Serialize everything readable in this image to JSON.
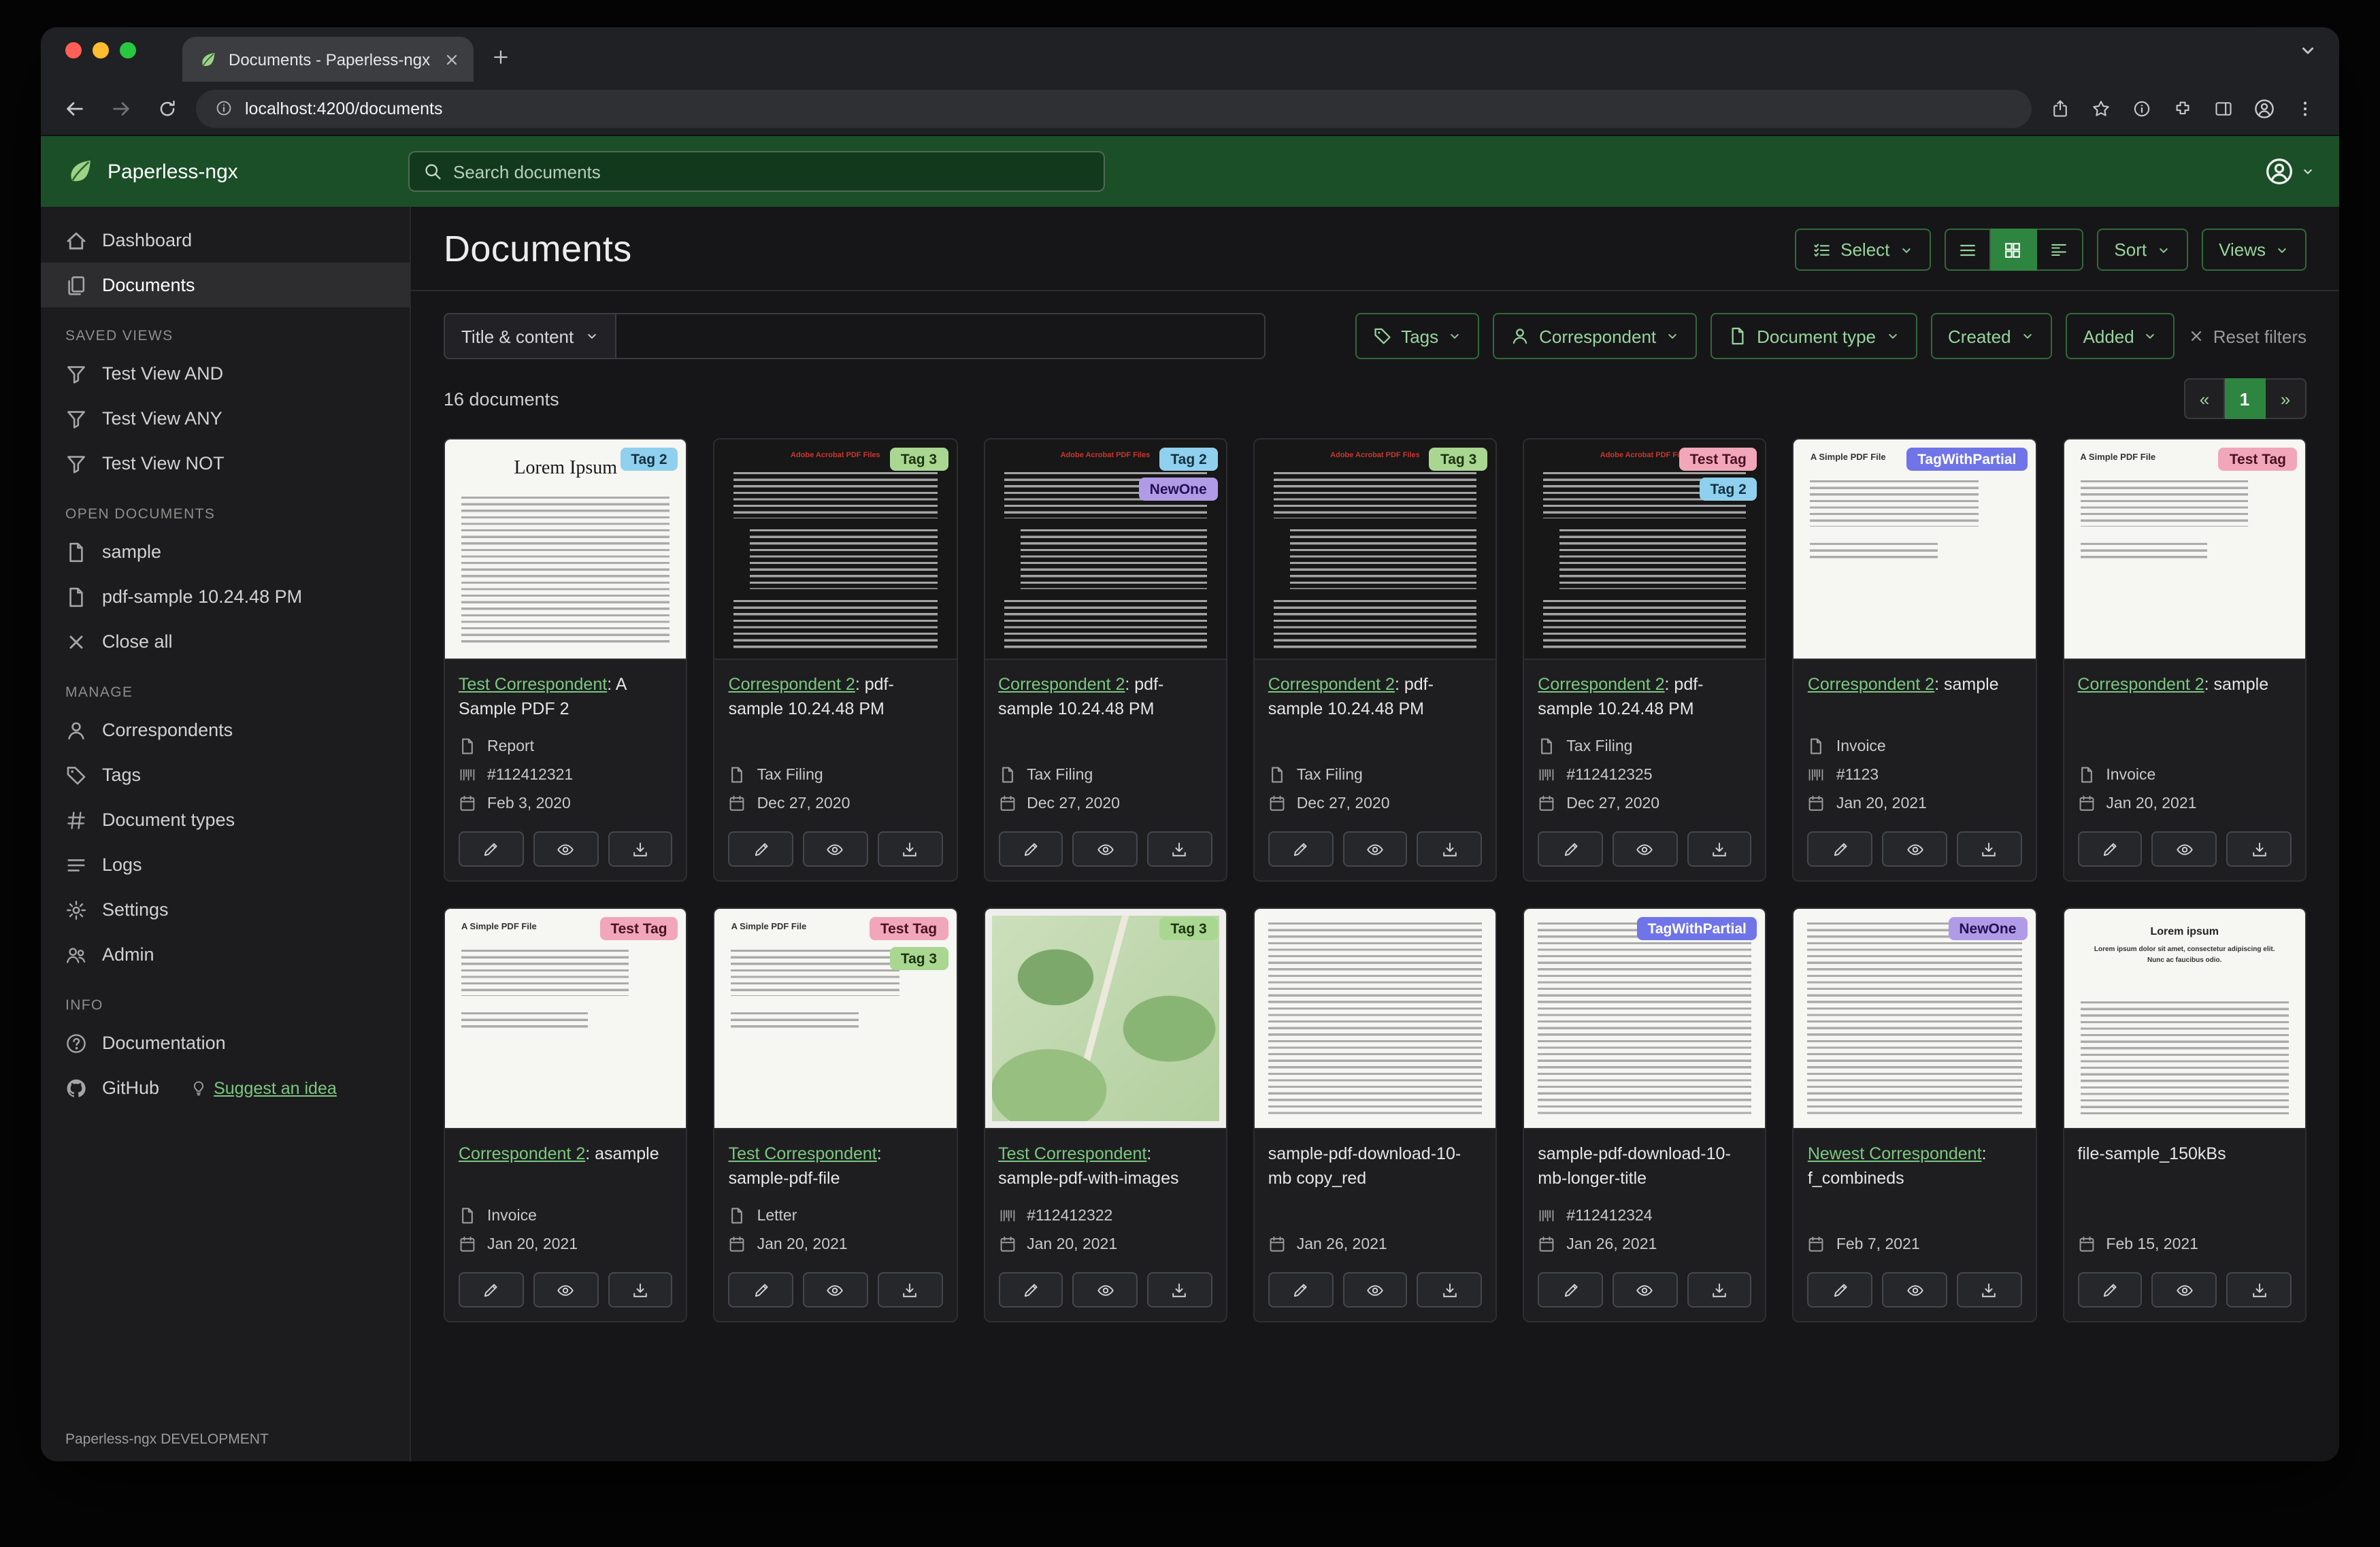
{
  "browser": {
    "tab_title": "Documents - Paperless-ngx",
    "url_host": "localhost:4200",
    "url_path": "/documents"
  },
  "header": {
    "app_name": "Paperless-ngx",
    "search_placeholder": "Search documents"
  },
  "sidebar": {
    "dashboard": "Dashboard",
    "documents": "Documents",
    "saved_views_heading": "SAVED VIEWS",
    "saved_views": [
      "Test View AND",
      "Test View ANY",
      "Test View NOT"
    ],
    "open_documents_heading": "OPEN DOCUMENTS",
    "open_documents": [
      "sample",
      "pdf-sample 10.24.48 PM"
    ],
    "close_all": "Close all",
    "manage_heading": "MANAGE",
    "manage": [
      "Correspondents",
      "Tags",
      "Document types",
      "Logs",
      "Settings",
      "Admin"
    ],
    "info_heading": "INFO",
    "documentation": "Documentation",
    "github": "GitHub",
    "suggest_idea": "Suggest an idea",
    "footer": "Paperless-ngx DEVELOPMENT"
  },
  "main": {
    "title": "Documents",
    "select_label": "Select",
    "sort_label": "Sort",
    "views_label": "Views",
    "filter": {
      "title_content": "Title & content",
      "tags": "Tags",
      "correspondent": "Correspondent",
      "document_type": "Document type",
      "created": "Created",
      "added": "Added",
      "reset": "Reset filters"
    },
    "count": "16 documents",
    "pagination": {
      "prev": "«",
      "page": "1",
      "next": "»"
    }
  },
  "tag_colors": {
    "Tag 2": {
      "bg": "#8fd0ee",
      "fg": "#12303f"
    },
    "Tag 3": {
      "bg": "#a9d792",
      "fg": "#1c330f"
    },
    "NewOne": {
      "bg": "#b09be6",
      "fg": "#241055"
    },
    "Test Tag": {
      "bg": "#f2a6ba",
      "fg": "#471223"
    },
    "TagWithPartial": {
      "bg": "#6f74e8",
      "fg": "#ffffff"
    }
  },
  "documents": [
    {
      "tags": [
        "Tag 2"
      ],
      "correspondent": "Test Correspondent",
      "title_suffix": ": A Sample PDF 2",
      "title": null,
      "doc_type": "Report",
      "asn": "#112412321",
      "date": "Feb 3, 2020",
      "thumb": {
        "type": "lorem",
        "text": "Lorem Ipsum"
      }
    },
    {
      "tags": [
        "Tag 3"
      ],
      "correspondent": "Correspondent 2",
      "title_suffix": ": pdf-sample 10.24.48 PM",
      "title": null,
      "doc_type": "Tax Filing",
      "asn": null,
      "date": "Dec 27, 2020",
      "thumb": {
        "type": "adobe",
        "text": "Adobe Acrobat PDF Files"
      }
    },
    {
      "tags": [
        "Tag 2",
        "NewOne"
      ],
      "correspondent": "Correspondent 2",
      "title_suffix": ": pdf-sample 10.24.48 PM",
      "title": null,
      "doc_type": "Tax Filing",
      "asn": null,
      "date": "Dec 27, 2020",
      "thumb": {
        "type": "adobe",
        "text": "Adobe Acrobat PDF Files"
      }
    },
    {
      "tags": [
        "Tag 3"
      ],
      "correspondent": "Correspondent 2",
      "title_suffix": ": pdf-sample 10.24.48 PM",
      "title": null,
      "doc_type": "Tax Filing",
      "asn": null,
      "date": "Dec 27, 2020",
      "thumb": {
        "type": "adobe",
        "text": "Adobe Acrobat PDF Files"
      }
    },
    {
      "tags": [
        "Test Tag",
        "Tag 2"
      ],
      "correspondent": "Correspondent 2",
      "title_suffix": ": pdf-sample 10.24.48 PM",
      "title": null,
      "doc_type": "Tax Filing",
      "asn": "#112412325",
      "date": "Dec 27, 2020",
      "thumb": {
        "type": "adobe",
        "text": "Adobe Acrobat PDF Files"
      }
    },
    {
      "tags": [
        "TagWithPartial"
      ],
      "correspondent": "Correspondent 2",
      "title_suffix": ": sample",
      "title": null,
      "doc_type": "Invoice",
      "asn": "#1123",
      "date": "Jan 20, 2021",
      "thumb": {
        "type": "simple",
        "text": "A Simple PDF File"
      }
    },
    {
      "tags": [
        "Test Tag"
      ],
      "correspondent": "Correspondent 2",
      "title_suffix": ": sample",
      "title": null,
      "doc_type": "Invoice",
      "asn": null,
      "date": "Jan 20, 2021",
      "thumb": {
        "type": "simple",
        "text": "A Simple PDF File"
      }
    },
    {
      "tags": [
        "Test Tag"
      ],
      "correspondent": "Correspondent 2",
      "title_suffix": ": asample",
      "title": null,
      "doc_type": "Invoice",
      "asn": null,
      "date": "Jan 20, 2021",
      "thumb": {
        "type": "simple",
        "text": "A Simple PDF File"
      }
    },
    {
      "tags": [
        "Test Tag",
        "Tag 3"
      ],
      "correspondent": "Test Correspondent",
      "title_suffix": ": sample-pdf-file",
      "title": null,
      "doc_type": "Letter",
      "asn": null,
      "date": "Jan 20, 2021",
      "thumb": {
        "type": "simple",
        "text": "A Simple PDF File"
      }
    },
    {
      "tags": [
        "Tag 3"
      ],
      "correspondent": "Test Correspondent",
      "title_suffix": ": sample-pdf-with-images",
      "title": null,
      "doc_type": null,
      "asn": "#112412322",
      "date": "Jan 20, 2021",
      "thumb": {
        "type": "map",
        "text": ""
      }
    },
    {
      "tags": [],
      "correspondent": null,
      "title_suffix": null,
      "title": "sample-pdf-download-10-mb copy_red",
      "doc_type": null,
      "asn": null,
      "date": "Jan 26, 2021",
      "thumb": {
        "type": "dense",
        "text": ""
      }
    },
    {
      "tags": [
        "TagWithPartial"
      ],
      "correspondent": null,
      "title_suffix": null,
      "title": "sample-pdf-download-10-mb-longer-title",
      "doc_type": null,
      "asn": "#112412324",
      "date": "Jan 26, 2021",
      "thumb": {
        "type": "dense",
        "text": ""
      }
    },
    {
      "tags": [
        "NewOne"
      ],
      "correspondent": "Newest Correspondent",
      "title_suffix": ": f_combineds",
      "title": null,
      "doc_type": null,
      "asn": null,
      "date": "Feb 7, 2021",
      "thumb": {
        "type": "dense",
        "text": ""
      }
    },
    {
      "tags": [],
      "correspondent": null,
      "title_suffix": null,
      "title": "file-sample_150kBs",
      "doc_type": null,
      "asn": null,
      "date": "Feb 15, 2021",
      "thumb": {
        "type": "lorem2",
        "text": "Lorem ipsum",
        "sub": "Lorem ipsum dolor sit amet, consectetur adipiscing elit. Nunc ac faucibus odio."
      }
    }
  ]
}
